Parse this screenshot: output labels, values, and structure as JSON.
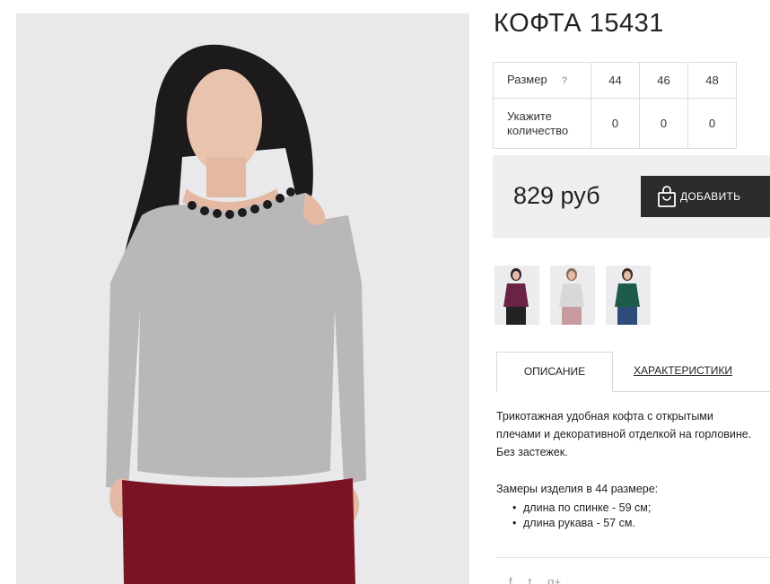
{
  "product": {
    "title": "КОФТА 15431",
    "photo_alt": "product-photo"
  },
  "sizes": {
    "size_label": "Размер",
    "hint": "?",
    "values": [
      "44",
      "46",
      "48"
    ],
    "qty_label_line1": "Укажите",
    "qty_label_line2": "количество",
    "quantities": [
      "0",
      "0",
      "0"
    ]
  },
  "purchase": {
    "price": "829 руб",
    "add_label": "ДОБАВИТЬ"
  },
  "thumbnails": [
    {
      "color": "#6b2345",
      "pants": "#222222"
    },
    {
      "color": "#d8d8d8",
      "pants": "#c99aa0"
    },
    {
      "color": "#1e5a4a",
      "pants": "#2e4c7a"
    }
  ],
  "tabs": {
    "description": "ОПИСАНИЕ",
    "characteristics": "ХАРАКТЕРИСТИКИ"
  },
  "description": {
    "line1": "Трикотажная удобная кофта с открытыми",
    "line2": "плечами и декоративной отделкой на горловине.",
    "line3": "Без застежек.",
    "measures_title": "Замеры изделия в 44 размере:",
    "measures": [
      "длина по спинке - 59 см;",
      "длина рукава - 57 см."
    ]
  },
  "social": {
    "facebook": "f",
    "twitter": "t",
    "gplus": "g+"
  },
  "colors": {
    "button_bg": "#2b2b2b",
    "price_box_bg": "#efefef",
    "sweater": "#b9b7b8",
    "pants": "#7a1424"
  }
}
